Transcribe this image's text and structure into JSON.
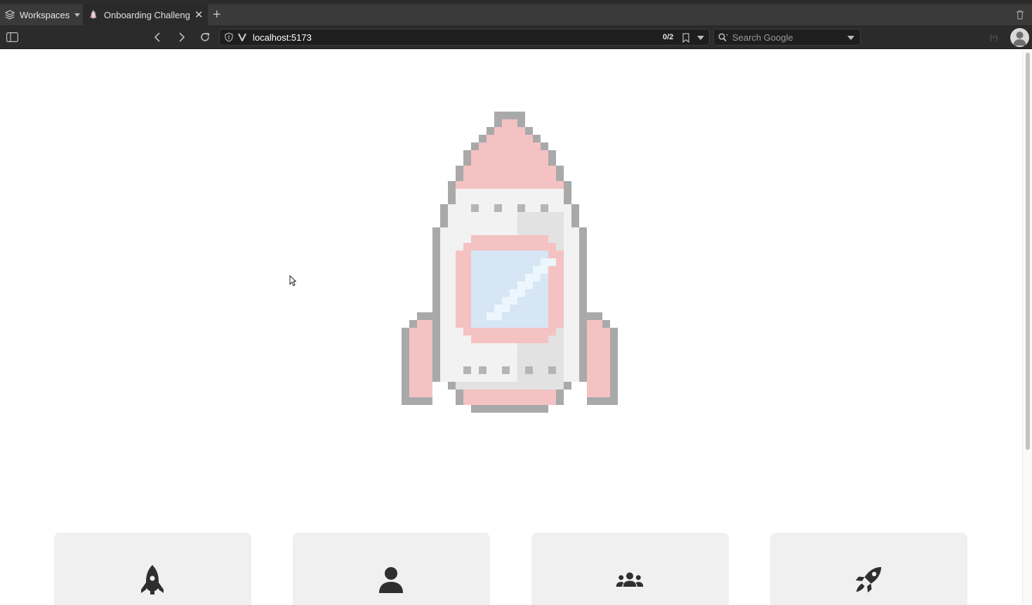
{
  "browser": {
    "workspaces_label": "Workspaces",
    "tab_title": "Onboarding Challenge",
    "new_tab_symbol": "+",
    "close_tab_symbol": "✕",
    "url": "localhost:5173",
    "match_count": "0/2",
    "search_placeholder": "Search Google",
    "extension_label": "{+}"
  },
  "page": {
    "hero_image": "pixel-rocket",
    "cards": [
      {
        "icon": "rocket-icon"
      },
      {
        "icon": "user-icon"
      },
      {
        "icon": "users-group-icon"
      },
      {
        "icon": "rocket-launch-icon"
      }
    ]
  },
  "colors": {
    "rocket_pink": "#f4c2c2",
    "rocket_gray": "#a9a9a9",
    "rocket_white": "#f2f2f2",
    "window_blue": "#d6e6f4",
    "card_bg": "#f0f0f0",
    "icon_dark": "#2f2f2f"
  }
}
